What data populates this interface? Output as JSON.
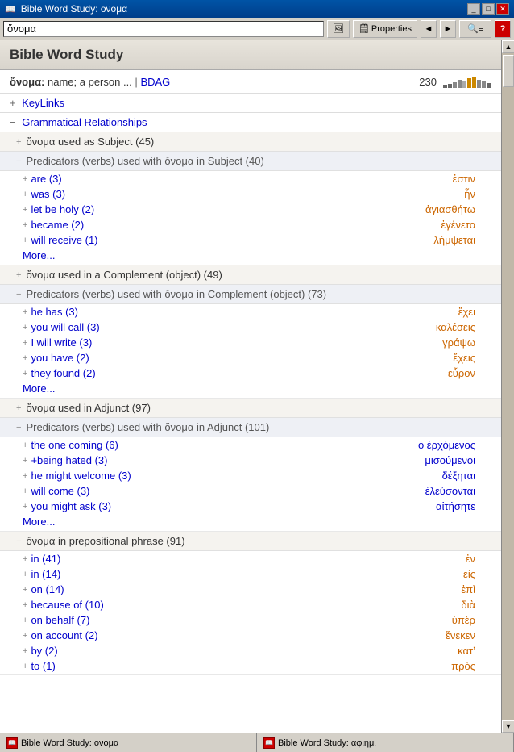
{
  "titleBar": {
    "title": "Bible Word Study: ονομα",
    "icon": "📖"
  },
  "toolbar": {
    "inputValue": "ὄνομα",
    "propertiesLabel": "Properties",
    "backLabel": "◄",
    "forwardLabel": "►"
  },
  "header": {
    "title": "Bible Word Study"
  },
  "wordInfo": {
    "word": "ὄνομα:",
    "definition": " name; a person ...",
    "source": "BDAG",
    "count": "230"
  },
  "miniChart": {
    "bars": [
      2,
      3,
      4,
      6,
      5,
      8,
      10,
      7,
      5,
      4,
      6,
      8
    ]
  },
  "sections": {
    "keyLinks": {
      "toggle": "+",
      "label": "KeyLinks"
    },
    "grammatical": {
      "toggle": "−",
      "label": "Grammatical Relationships"
    }
  },
  "subsections": [
    {
      "toggle": "+",
      "title": "ὄνομα used as Subject (45)"
    }
  ],
  "predicators1": {
    "toggle": "−",
    "title": "Predicators (verbs) used with ὄνομα in Subject (40)"
  },
  "predicators1Items": [
    {
      "label": "are (3)",
      "greek": "ἐστιν",
      "greekColor": "orange"
    },
    {
      "label": "was (3)",
      "greek": "ἦν",
      "greekColor": "orange"
    },
    {
      "label": "let be holy (2)",
      "greek": "ἁγιασθήτω",
      "greekColor": "orange"
    },
    {
      "label": "became (2)",
      "greek": "ἐγένετο",
      "greekColor": "orange"
    },
    {
      "label": "will receive (1)",
      "greek": "λήμψεται",
      "greekColor": "orange"
    }
  ],
  "more1": "More...",
  "subsections2": [
    {
      "toggle": "+",
      "title": "ὄνομα used in a Complement (object) (49)"
    }
  ],
  "predicators2": {
    "toggle": "−",
    "title": "Predicators (verbs) used with ὄνομα in Complement (object) (73)"
  },
  "predicators2Items": [
    {
      "label": "he has (3)",
      "greek": "ἔχει",
      "greekColor": "orange"
    },
    {
      "label": "you will call (3)",
      "greek": "καλέσεις",
      "greekColor": "orange"
    },
    {
      "label": "I will write (3)",
      "greek": "γράψω",
      "greekColor": "orange"
    },
    {
      "label": "you have (2)",
      "greek": "ἔχεις",
      "greekColor": "orange"
    },
    {
      "label": "they found (2)",
      "greek": "εὗρον",
      "greekColor": "orange"
    }
  ],
  "more2": "More...",
  "subsections3": [
    {
      "toggle": "+",
      "title": "ὄνομα used in Adjunct (97)"
    }
  ],
  "predicators3": {
    "toggle": "−",
    "title": "Predicators (verbs) used with ὄνομα in Adjunct (101)"
  },
  "predicators3Items": [
    {
      "label": "the one coming (6)",
      "greek": "ὁ ἐρχόμενος",
      "greekColor": "blue"
    },
    {
      "label": "+being hated (3)",
      "greek": "μισούμενοι",
      "greekColor": "blue"
    },
    {
      "label": "he might welcome (3)",
      "greek": "δέξηται",
      "greekColor": "blue"
    },
    {
      "label": "will come (3)",
      "greek": "ἐλεύσονται",
      "greekColor": "blue"
    },
    {
      "label": "you might ask (3)",
      "greek": "αἰτήσητε",
      "greekColor": "blue"
    }
  ],
  "more3": "More...",
  "subsections4": [
    {
      "toggle": "−",
      "title": "ὄνομα in prepositional phrase (91)"
    }
  ],
  "prepItems": [
    {
      "label": "in (41)",
      "greek": "ἐν",
      "greekColor": "orange"
    },
    {
      "label": "in (14)",
      "greek": "εἰς",
      "greekColor": "orange"
    },
    {
      "label": "on (14)",
      "greek": "ἐπὶ",
      "greekColor": "orange"
    },
    {
      "label": "because of (10)",
      "greek": "διὰ",
      "greekColor": "orange"
    },
    {
      "label": "on behalf (7)",
      "greek": "ὑπὲρ",
      "greekColor": "orange"
    },
    {
      "label": "on account (2)",
      "greek": "ἕνεκεν",
      "greekColor": "orange"
    },
    {
      "label": "by (2)",
      "greek": "κατʼ",
      "greekColor": "orange"
    },
    {
      "label": "to (1)",
      "greek": "πρὸς",
      "greekColor": "orange"
    }
  ],
  "statusBar": {
    "item1": "Bible Word Study: ονομα",
    "item2": "Bible Word Study: αφιημι"
  }
}
